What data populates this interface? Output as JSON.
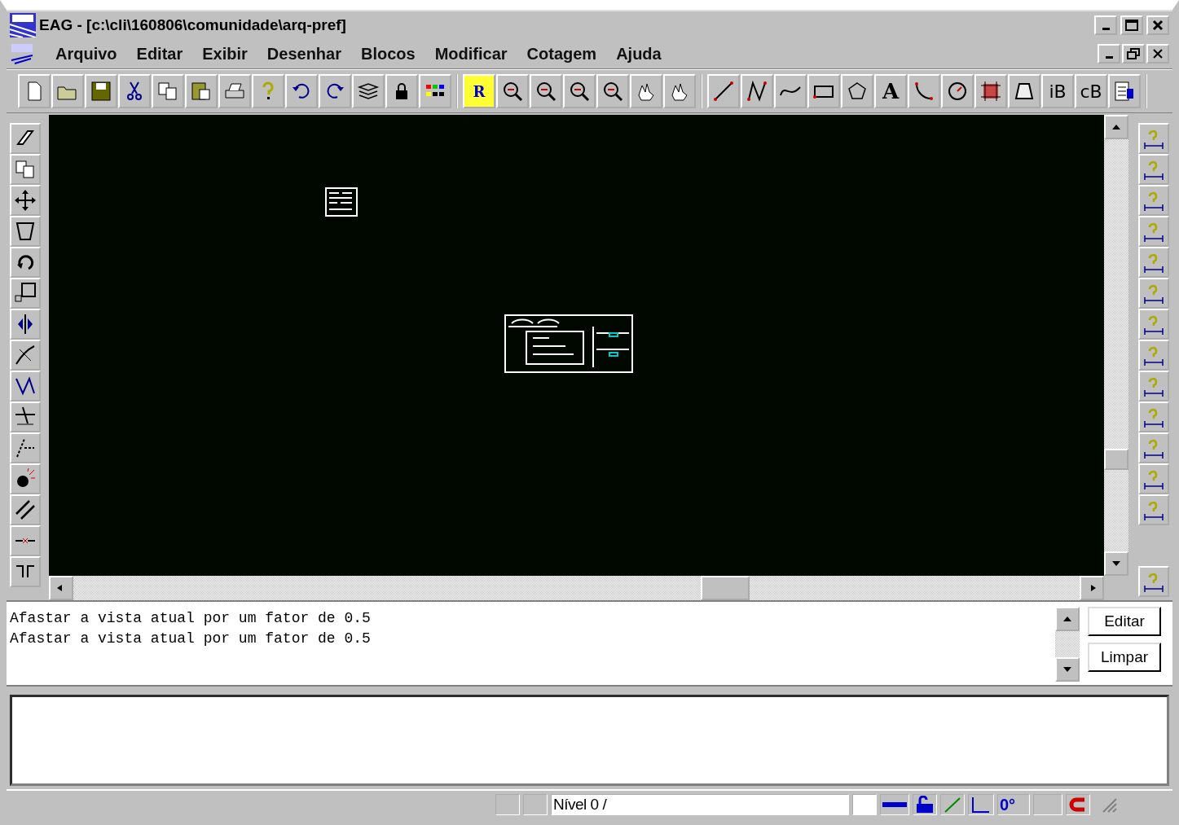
{
  "window": {
    "title": "EAG - [c:\\cli\\160806\\comunidade\\arq-pref]"
  },
  "menu": [
    "Arquivo",
    "Editar",
    "Exibir",
    "Desenhar",
    "Blocos",
    "Modificar",
    "Cotagem",
    "Ajuda"
  ],
  "toolbar_groups": [
    [
      {
        "kind": "new"
      },
      {
        "kind": "open"
      },
      {
        "kind": "save"
      },
      {
        "kind": "cut"
      },
      {
        "kind": "copy"
      },
      {
        "kind": "paste"
      },
      {
        "kind": "print"
      },
      {
        "kind": "help"
      },
      {
        "kind": "undo"
      },
      {
        "kind": "redo"
      },
      {
        "kind": "layers"
      },
      {
        "kind": "lock"
      },
      {
        "kind": "palette"
      }
    ],
    [
      {
        "kind": "zoomall",
        "label": "R"
      },
      {
        "kind": "zoom"
      },
      {
        "kind": "zoom"
      },
      {
        "kind": "zoom"
      },
      {
        "kind": "zoom"
      },
      {
        "kind": "pan"
      },
      {
        "kind": "pan"
      }
    ],
    [
      {
        "kind": "line"
      },
      {
        "kind": "polyline"
      },
      {
        "kind": "curve"
      },
      {
        "kind": "rectangle"
      },
      {
        "kind": "polygon"
      },
      {
        "kind": "text",
        "label": "A"
      },
      {
        "kind": "arc"
      },
      {
        "kind": "circle"
      },
      {
        "kind": "hatch"
      },
      {
        "kind": "trapezoid"
      },
      {
        "kind": "block",
        "label": "iB"
      },
      {
        "kind": "block",
        "label": "cB"
      },
      {
        "kind": "list"
      }
    ]
  ],
  "left_toolbar": [
    {
      "kind": "erase"
    },
    {
      "kind": "duplicate"
    },
    {
      "kind": "move"
    },
    {
      "kind": "stretch"
    },
    {
      "kind": "rotate"
    },
    {
      "kind": "scale"
    },
    {
      "kind": "mirror"
    },
    {
      "kind": "trim"
    },
    {
      "kind": "extend"
    },
    {
      "kind": "offset"
    },
    {
      "kind": "break"
    },
    {
      "kind": "explode"
    },
    {
      "kind": "parallel"
    },
    {
      "kind": "join"
    },
    {
      "kind": "array"
    }
  ],
  "right_toolbar": [
    {
      "kind": "dimension"
    },
    {
      "kind": "dimension"
    },
    {
      "kind": "dimension"
    },
    {
      "kind": "dimension"
    },
    {
      "kind": "dimension"
    },
    {
      "kind": "dimension"
    },
    {
      "kind": "dimension"
    },
    {
      "kind": "dimension"
    },
    {
      "kind": "dimension"
    },
    {
      "kind": "dimension"
    },
    {
      "kind": "dimension"
    },
    {
      "kind": "dimension"
    },
    {
      "kind": "dimension"
    }
  ],
  "right_toolbar_bottom": {
    "kind": "dimension"
  },
  "messages": [
    "Afastar a vista atual por um fator de 0.5",
    "Afastar a vista atual por um fator de 0.5"
  ],
  "message_buttons": [
    "Editar",
    "Limpar"
  ],
  "status_bar": {
    "layer": "Nível 0 /",
    "angle": "0°"
  }
}
